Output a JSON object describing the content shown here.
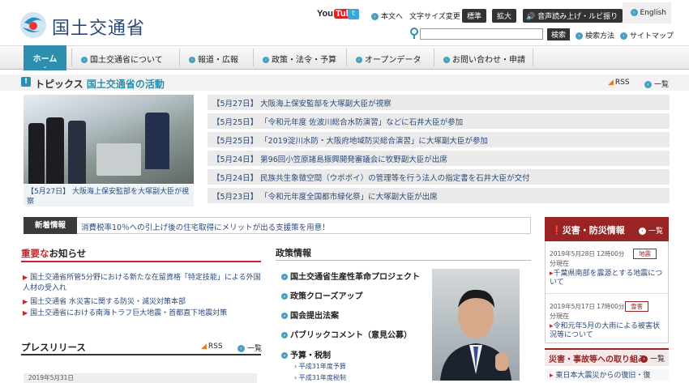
{
  "header": {
    "site_title": "国土交通省",
    "youtube_a": "You",
    "youtube_b": "Tube",
    "honbun": "本文へ",
    "fontsize_label": "文字サイズ変更",
    "btn_standard": "標準",
    "btn_large": "拡大",
    "btn_voice": "音声読み上げ・ルビ振り",
    "english": "English",
    "search_placeholder": "",
    "search_button": "検索",
    "search_method": "検索方法",
    "sitemap": "サイトマップ"
  },
  "nav": {
    "home": "ホーム",
    "items": [
      "国土交通省について",
      "報道・広報",
      "政策・法令・予算",
      "オープンデータ",
      "お問い合わせ・申請"
    ]
  },
  "topics": {
    "label_a": "トピックス",
    "label_b": "国土交通省の活動",
    "rss": "RSS",
    "list": "一覧",
    "photo_caption": "【5月27日】 大阪海上保安監部を大塚副大臣が視察",
    "items": [
      "【5月27日】 大阪海上保安監部を大塚副大臣が視察",
      "【5月25日】 「令和元年度 佐波川総合水防演習」などに石井大臣が参加",
      "【5月25日】 「2019淀川水防・大阪府地域防災総合演習」に大塚副大臣が参加",
      "【5月24日】 第96回小笠原諸島振興開発審議会に牧野副大臣が出席",
      "【5月24日】 民族共生象徴空間（ウポポイ）の管理等を行う法人の指定書を石井大臣が交付",
      "【5月23日】 「令和元年度全国都市緑化祭」に大塚副大臣が出席"
    ]
  },
  "news": {
    "label": "新着情報",
    "text": "消費税率10％への引上げ後の住宅取得にメリットが出る支援策を用意！"
  },
  "disaster": {
    "title": "災害・防災情報",
    "list": "一覧",
    "entries": [
      {
        "date": "2019年5月28日 12時00分",
        "sub": "分現在",
        "tag": "地震",
        "link": "千葉県南部を震源とする地震について"
      },
      {
        "date": "2019年5月17日 17時00分",
        "sub": "分現在",
        "tag": "雪害",
        "link": "令和元年5月の大雨による被害状況等について"
      }
    ],
    "second_title": "災害・事故等への取り組み",
    "second_list": "一覧",
    "third": "東日本大震災からの復旧・復"
  },
  "notice": {
    "title_red": "重要な",
    "title_rest": "お知らせ",
    "items": [
      "国土交通省所管5分野における新たな在留資格「特定技能」による外国人材の受入れ",
      "国土交通省 水災害に関する防災・減災対策本部",
      "国土交通省における南海トラフ巨大地震・首都直下地震対策"
    ]
  },
  "press": {
    "title": "プレスリリース",
    "rss": "RSS",
    "list": "一覧",
    "date": "2019年5月31日"
  },
  "policy": {
    "title": "政策情報",
    "items": [
      "国土交通省生産性革命プロジェクト",
      "政策クローズアップ",
      "国会提出法案",
      "パブリックコメント（意見公募）",
      "予算・税制"
    ],
    "subs": [
      "平成31年度予算",
      "平成31年度税制"
    ]
  },
  "colors": {
    "accent": "#2c8fae",
    "disaster": "#9a2424",
    "notice_red": "#c1272d"
  }
}
